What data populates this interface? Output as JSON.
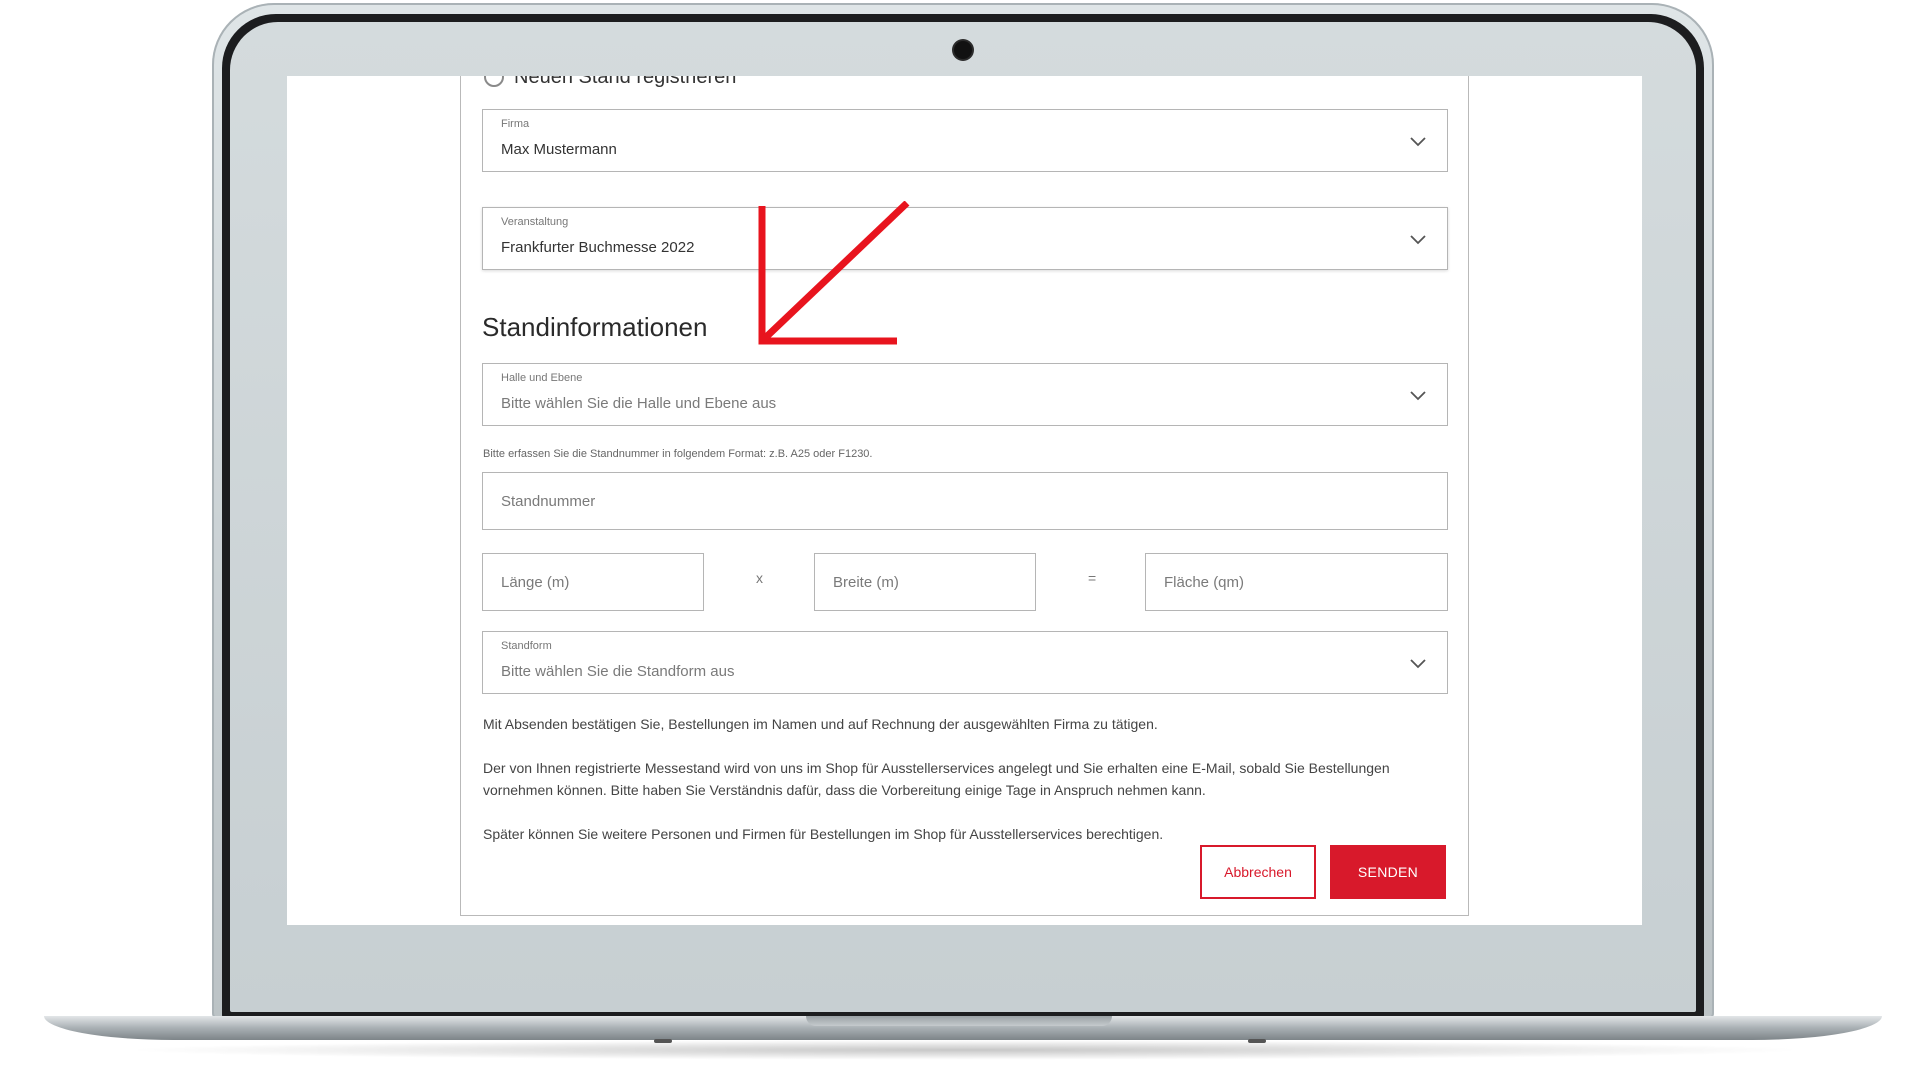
{
  "form": {
    "radio_option": "Neuen Stand registrieren",
    "company": {
      "label": "Firma",
      "value": "Max Mustermann"
    },
    "event": {
      "label": "Veranstaltung",
      "value": "Frankfurter Buchmesse 2022"
    },
    "section_title": "Standinformationen",
    "hall": {
      "label": "Halle und Ebene",
      "placeholder": "Bitte wählen Sie die Halle und Ebene aus"
    },
    "stand_hint": "Bitte erfassen Sie die Standnummer in folgendem Format: z.B. A25 oder F1230.",
    "stand_number": {
      "placeholder": "Standnummer"
    },
    "length": {
      "placeholder": "Länge (m)"
    },
    "multiply_symbol": "x",
    "width": {
      "placeholder": "Breite (m)"
    },
    "equals_symbol": "=",
    "area": {
      "placeholder": "Fläche (qm)"
    },
    "stand_form": {
      "label": "Standform",
      "placeholder": "Bitte wählen Sie die Standform aus"
    },
    "info_1": "Mit Absenden bestätigen Sie, Bestellungen im Namen und auf Rechnung der ausgewählten Firma zu tätigen.",
    "info_2": "Der von Ihnen registrierte Messestand wird von uns im Shop für Ausstellerservices angelegt und Sie erhalten eine E-Mail, sobald Sie Bestellungen vornehmen können. Bitte haben Sie Verständnis dafür, dass die Vorbereitung einige Tage in Anspruch nehmen kann.",
    "info_3": "Später können Sie weitere Personen und Firmen für Bestellungen im Shop für Ausstellerservices berechtigen.",
    "cancel_label": "Abbrechen",
    "send_label": "SENDEN"
  },
  "colors": {
    "accent": "#d8192b",
    "annotation_arrow": "#e8141e"
  },
  "icons": {
    "dropdown": "chevron-down-icon",
    "radio": "radio-button-icon",
    "annotation": "arrow-annotation-icon"
  }
}
